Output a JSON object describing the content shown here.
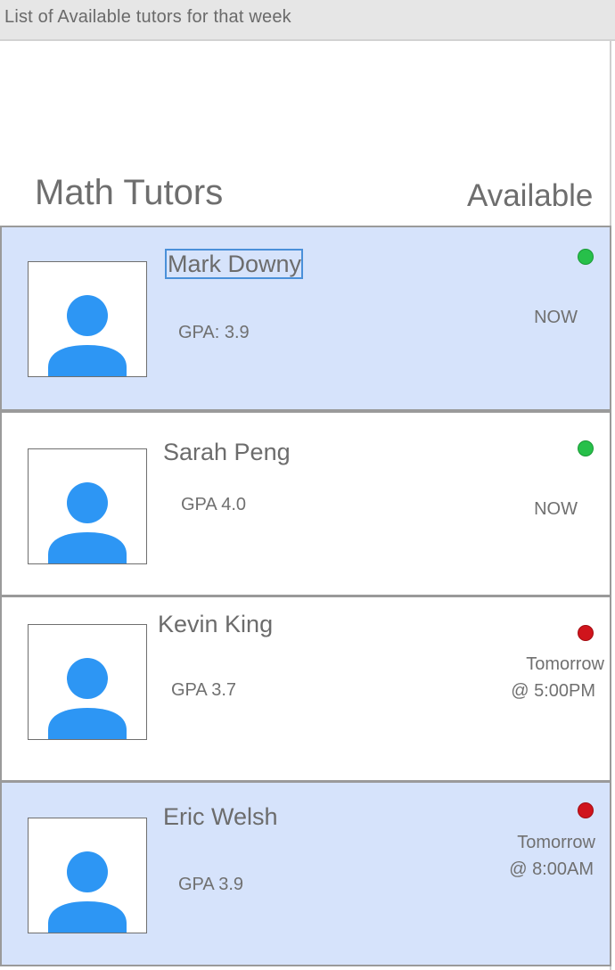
{
  "window": {
    "title": "List of Available tutors for that week"
  },
  "header": {
    "section_title": "Math Tutors",
    "available_label": "Available"
  },
  "colors": {
    "highlight_bg": "#d6e3fb",
    "avatar_blue": "#2d96f4",
    "status_available": "#27c04a",
    "status_unavailable": "#d0141c"
  },
  "tutors": [
    {
      "name": "Mark Downy",
      "gpa": "GPA: 3.9",
      "status": "available",
      "availability": [
        "NOW"
      ],
      "avatar_icon": "person-icon"
    },
    {
      "name": "Sarah Peng",
      "gpa": "GPA 4.0",
      "status": "available",
      "availability": [
        "NOW"
      ],
      "avatar_icon": "person-icon"
    },
    {
      "name": "Kevin King",
      "gpa": "GPA 3.7",
      "status": "unavailable",
      "availability": [
        "Tomorrow",
        "@ 5:00PM"
      ],
      "avatar_icon": "person-icon"
    },
    {
      "name": "Eric Welsh",
      "gpa": "GPA 3.9",
      "status": "unavailable",
      "availability": [
        "Tomorrow",
        "@ 8:00AM"
      ],
      "avatar_icon": "person-icon"
    }
  ]
}
